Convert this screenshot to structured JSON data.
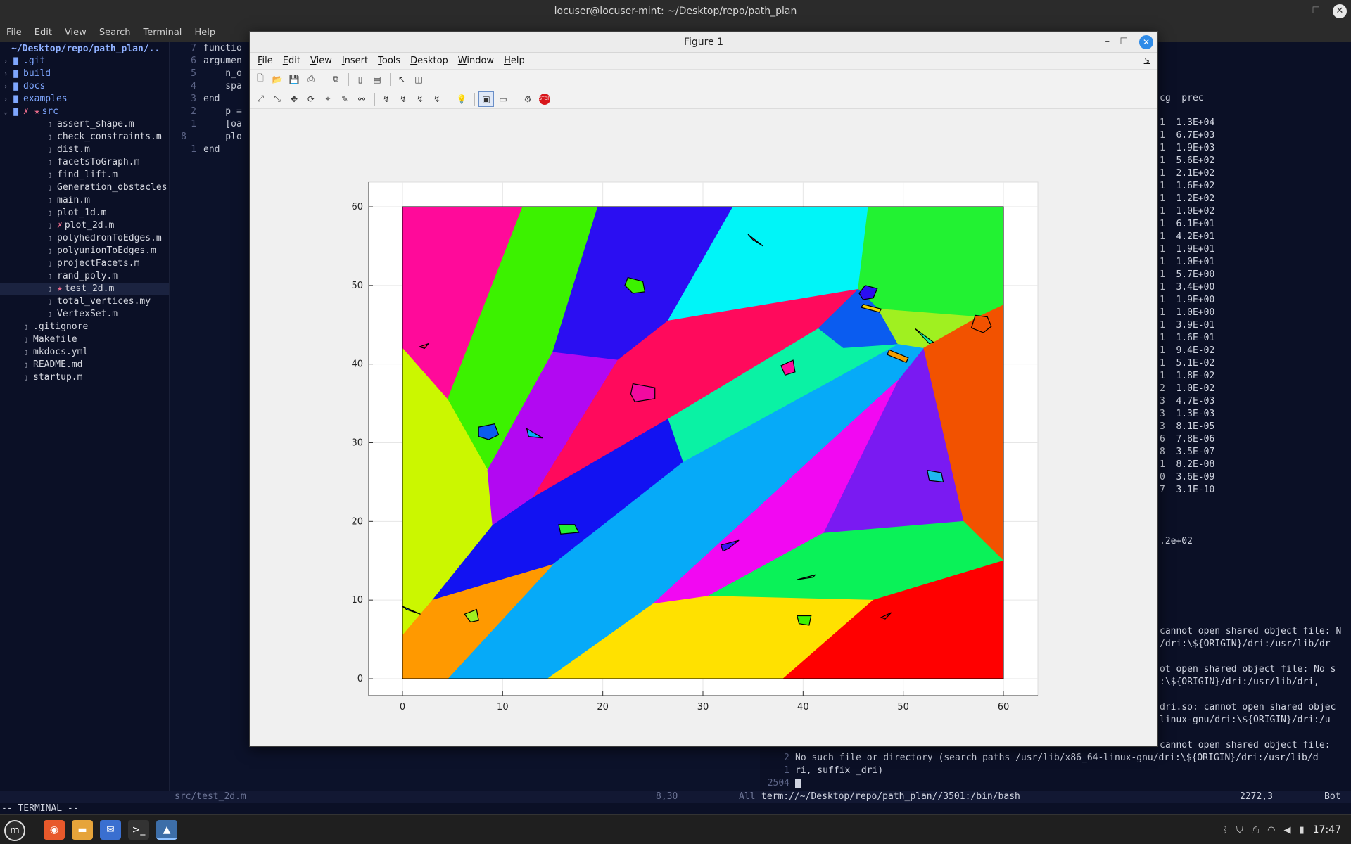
{
  "terminal_window": {
    "title": "locuser@locuser-mint: ~/Desktop/repo/path_plan",
    "menu": [
      "File",
      "Edit",
      "View",
      "Search",
      "Terminal",
      "Help"
    ]
  },
  "file_tree": {
    "root": "~/Desktop/repo/path_plan/..",
    "items": [
      {
        "name": ".git",
        "type": "dir",
        "arrow": "›",
        "marks": ""
      },
      {
        "name": "build",
        "type": "dir",
        "arrow": "›",
        "marks": ""
      },
      {
        "name": "docs",
        "type": "dir",
        "arrow": "›",
        "marks": ""
      },
      {
        "name": "examples",
        "type": "dir",
        "arrow": "›",
        "marks": ""
      },
      {
        "name": "src",
        "type": "dir",
        "arrow": "⌄",
        "marks": "✗ ★"
      },
      {
        "name": "assert_shape.m",
        "type": "file",
        "indent": 1,
        "marks": ""
      },
      {
        "name": "check_constraints.m",
        "type": "file",
        "indent": 1,
        "marks": ""
      },
      {
        "name": "dist.m",
        "type": "file",
        "indent": 1,
        "marks": ""
      },
      {
        "name": "facetsToGraph.m",
        "type": "file",
        "indent": 1,
        "marks": ""
      },
      {
        "name": "find_lift.m",
        "type": "file",
        "indent": 1,
        "marks": ""
      },
      {
        "name": "Generation_obstacles.m",
        "type": "file",
        "indent": 1,
        "marks": ""
      },
      {
        "name": "main.m",
        "type": "file",
        "indent": 1,
        "marks": ""
      },
      {
        "name": "plot_1d.m",
        "type": "file",
        "indent": 1,
        "marks": ""
      },
      {
        "name": "plot_2d.m",
        "type": "file",
        "indent": 1,
        "marks": "✗"
      },
      {
        "name": "polyhedronToEdges.m",
        "type": "file",
        "indent": 1,
        "marks": ""
      },
      {
        "name": "polyunionToEdges.m",
        "type": "file",
        "indent": 1,
        "marks": ""
      },
      {
        "name": "projectFacets.m",
        "type": "file",
        "indent": 1,
        "marks": ""
      },
      {
        "name": "rand_poly.m",
        "type": "file",
        "indent": 1,
        "marks": ""
      },
      {
        "name": "test_2d.m",
        "type": "file",
        "indent": 1,
        "marks": "★",
        "selected": true
      },
      {
        "name": "total_vertices.my",
        "type": "file",
        "indent": 1,
        "marks": ""
      },
      {
        "name": "VertexSet.m",
        "type": "file",
        "indent": 1,
        "marks": ""
      },
      {
        "name": ".gitignore",
        "type": "file",
        "indent": 0,
        "marks": ""
      },
      {
        "name": "Makefile",
        "type": "file",
        "indent": 0,
        "marks": ""
      },
      {
        "name": "mkdocs.yml",
        "type": "file",
        "indent": 0,
        "marks": ""
      },
      {
        "name": "README.md",
        "type": "file",
        "indent": 0,
        "marks": ""
      },
      {
        "name": "startup.m",
        "type": "file",
        "indent": 0,
        "marks": ""
      }
    ]
  },
  "editor": {
    "lines": [
      {
        "ln": "7",
        "text": "functio"
      },
      {
        "ln": "6",
        "text": "argumen"
      },
      {
        "ln": "5",
        "text": "    n_o"
      },
      {
        "ln": "4",
        "text": "    spa"
      },
      {
        "ln": "3",
        "text": "end"
      },
      {
        "ln": "2",
        "text": "    p ="
      },
      {
        "ln": "1",
        "text": "    [oa"
      },
      {
        "ln": "8",
        "text": "    plo"
      },
      {
        "ln": "1",
        "text": "end"
      }
    ]
  },
  "solver_output": {
    "header": "cg  prec",
    "rows": [
      "1  1.3E+04",
      "1  6.7E+03",
      "1  1.9E+03",
      "1  5.6E+02",
      "1  2.1E+02",
      "1  1.6E+02",
      "1  1.2E+02",
      "1  1.0E+02",
      "1  6.1E+01",
      "1  4.2E+01",
      "1  1.9E+01",
      "1  1.0E+01",
      "1  5.7E+00",
      "1  3.4E+00",
      "1  1.9E+00",
      "1  1.0E+00",
      "1  3.9E-01",
      "1  1.6E-01",
      "1  9.4E-02",
      "1  5.1E-02",
      "1  1.8E-02",
      "2  1.0E-02",
      "3  4.7E-03",
      "3  1.3E-03",
      "3  8.1E-05",
      "6  7.8E-06",
      "8  3.5E-07",
      "1  8.2E-08",
      "0  3.6E-09",
      "7  3.1E-10"
    ],
    "tail_value": ".2e+02",
    "errors": [
      "cannot open shared object file: N",
      "/dri:\\${ORIGIN}/dri:/usr/lib/dr",
      "ot open shared object file: No s",
      ":\\${ORIGIN}/dri:/usr/lib/dri,",
      "dri.so: cannot open shared objec",
      "linux-gnu/dri:\\${ORIGIN}/dri:/u",
      "cannot open shared object file:"
    ]
  },
  "bottom_terminal": {
    "lines": [
      {
        "ln": "2",
        "text": "No such file or directory (search paths /usr/lib/x86_64-linux-gnu/dri:\\${ORIGIN}/dri:/usr/lib/d"
      },
      {
        "ln": "1",
        "text": "ri, suffix _dri)"
      },
      {
        "ln": "2504",
        "text": ""
      }
    ]
  },
  "statusline": {
    "left_file": "src/test_2d.m",
    "left_pos": "8,30",
    "left_all": "All",
    "term_path": "term://~/Desktop/repo/path_plan//3501:/bin/bash",
    "right_pos": "2272,3",
    "right_bot": "Bot"
  },
  "mode": "-- TERMINAL --",
  "figure": {
    "title": "Figure 1",
    "menu": [
      "File",
      "Edit",
      "View",
      "Insert",
      "Tools",
      "Desktop",
      "Window",
      "Help"
    ]
  },
  "taskbar": {
    "clock": "17:47"
  },
  "chart_data": {
    "type": "polygon-partition",
    "xlim": [
      0,
      60
    ],
    "ylim": [
      0,
      60
    ],
    "xticks": [
      0,
      10,
      20,
      30,
      40,
      50,
      60
    ],
    "yticks": [
      0,
      10,
      20,
      30,
      40,
      50,
      60
    ],
    "regions": [
      {
        "color": "#ff0a9a",
        "pts": [
          [
            0,
            60
          ],
          [
            12,
            60
          ],
          [
            4.5,
            35.5
          ],
          [
            0,
            42
          ]
        ]
      },
      {
        "color": "#3cf200",
        "pts": [
          [
            12,
            60
          ],
          [
            19.5,
            60
          ],
          [
            15,
            41.5
          ],
          [
            8.5,
            26.5
          ],
          [
            4.5,
            35.5
          ]
        ]
      },
      {
        "color": "#2b0ef2",
        "pts": [
          [
            19.5,
            60
          ],
          [
            33,
            60
          ],
          [
            26.5,
            45.5
          ],
          [
            21.5,
            40.5
          ],
          [
            15,
            41.5
          ]
        ]
      },
      {
        "color": "#00f5f8",
        "pts": [
          [
            33,
            60
          ],
          [
            46.5,
            60
          ],
          [
            45.5,
            49.5
          ],
          [
            26.5,
            45.5
          ]
        ]
      },
      {
        "color": "#22f232",
        "pts": [
          [
            46.5,
            60
          ],
          [
            60,
            60
          ],
          [
            60,
            47.5
          ],
          [
            57.5,
            46
          ],
          [
            47.5,
            47
          ],
          [
            45.5,
            49.5
          ]
        ]
      },
      {
        "color": "#cbf700",
        "pts": [
          [
            0,
            42
          ],
          [
            4.5,
            35.5
          ],
          [
            8.5,
            26.5
          ],
          [
            9,
            19.5
          ],
          [
            3,
            10
          ],
          [
            0,
            5.5
          ]
        ]
      },
      {
        "color": "#b208f2",
        "pts": [
          [
            15,
            41.5
          ],
          [
            21.5,
            40.5
          ],
          [
            13,
            23
          ],
          [
            9,
            19.5
          ],
          [
            8.5,
            26.5
          ]
        ]
      },
      {
        "color": "#ff0a5c",
        "pts": [
          [
            21.5,
            40.5
          ],
          [
            26.5,
            45.5
          ],
          [
            45.5,
            49.5
          ],
          [
            41.5,
            44.5
          ],
          [
            26.5,
            33
          ],
          [
            13,
            23
          ]
        ]
      },
      {
        "color": "#0a5cf0",
        "pts": [
          [
            45.5,
            49.5
          ],
          [
            47.5,
            47
          ],
          [
            49.5,
            42.5
          ],
          [
            44,
            42
          ],
          [
            41.5,
            44.5
          ]
        ]
      },
      {
        "color": "#a0f020",
        "pts": [
          [
            47.5,
            47
          ],
          [
            57.5,
            46
          ],
          [
            52,
            42
          ],
          [
            49.5,
            42.5
          ]
        ]
      },
      {
        "color": "#0af2a4",
        "pts": [
          [
            41.5,
            44.5
          ],
          [
            44,
            42
          ],
          [
            49.5,
            42.5
          ],
          [
            28,
            27.5
          ],
          [
            26.5,
            33
          ]
        ]
      },
      {
        "color": "#f25200",
        "pts": [
          [
            57.5,
            46
          ],
          [
            60,
            47.5
          ],
          [
            60,
            15
          ],
          [
            56,
            20
          ],
          [
            52,
            42
          ]
        ]
      },
      {
        "color": "#7a1af2",
        "pts": [
          [
            52,
            42
          ],
          [
            56,
            20
          ],
          [
            42,
            18.5
          ],
          [
            49.5,
            38
          ]
        ]
      },
      {
        "color": "#1212f2",
        "pts": [
          [
            13,
            23
          ],
          [
            26.5,
            33
          ],
          [
            28,
            27.5
          ],
          [
            15,
            14.5
          ],
          [
            3,
            10
          ],
          [
            9,
            19.5
          ]
        ]
      },
      {
        "color": "#06aaf8",
        "pts": [
          [
            49.5,
            42.5
          ],
          [
            52,
            42
          ],
          [
            49.5,
            38
          ],
          [
            25,
            9.5
          ],
          [
            14.5,
            0
          ],
          [
            4.5,
            0
          ],
          [
            15,
            14.5
          ],
          [
            28,
            27.5
          ]
        ]
      },
      {
        "color": "#f208f2",
        "pts": [
          [
            49.5,
            38
          ],
          [
            42,
            18.5
          ],
          [
            30.5,
            10.5
          ],
          [
            25,
            9.5
          ]
        ]
      },
      {
        "color": "#0af258",
        "pts": [
          [
            42,
            18.5
          ],
          [
            56,
            20
          ],
          [
            60,
            15
          ],
          [
            47,
            10
          ],
          [
            30.5,
            10.5
          ]
        ]
      },
      {
        "color": "#ff9900",
        "pts": [
          [
            0,
            5.5
          ],
          [
            3,
            10
          ],
          [
            15,
            14.5
          ],
          [
            4.5,
            0
          ],
          [
            0,
            0
          ]
        ]
      },
      {
        "color": "#ffe100",
        "pts": [
          [
            14.5,
            0
          ],
          [
            25,
            9.5
          ],
          [
            30.5,
            10.5
          ],
          [
            47,
            10
          ],
          [
            38,
            0
          ]
        ]
      },
      {
        "color": "#ff0000",
        "pts": [
          [
            38,
            0
          ],
          [
            47,
            10
          ],
          [
            60,
            15
          ],
          [
            60,
            0
          ]
        ]
      }
    ],
    "obstacles": [
      {
        "color": "#ff0a5c",
        "pts": [
          [
            34.5,
            56.5
          ],
          [
            36,
            55
          ],
          [
            35,
            55.8
          ]
        ]
      },
      {
        "color": "#3cf200",
        "pts": [
          [
            22.5,
            51
          ],
          [
            24,
            50.5
          ],
          [
            24.2,
            49.2
          ],
          [
            23,
            49
          ],
          [
            22.2,
            50
          ]
        ]
      },
      {
        "color": "#2b0ef2",
        "pts": [
          [
            46.2,
            50
          ],
          [
            47.4,
            49.6
          ],
          [
            47,
            48.4
          ],
          [
            46,
            48.2
          ],
          [
            45.6,
            49
          ]
        ]
      },
      {
        "color": "#f2d000",
        "pts": [
          [
            46,
            47.6
          ],
          [
            47.8,
            47
          ],
          [
            47.6,
            46.6
          ],
          [
            45.8,
            47.2
          ]
        ]
      },
      {
        "color": "#0af2a4",
        "pts": [
          [
            51.2,
            44.5
          ],
          [
            53,
            42.8
          ],
          [
            52.6,
            42.6
          ]
        ]
      },
      {
        "color": "#f25200",
        "pts": [
          [
            57.2,
            46.2
          ],
          [
            58.4,
            46
          ],
          [
            58.8,
            44.8
          ],
          [
            58,
            44
          ],
          [
            56.8,
            44.6
          ]
        ]
      },
      {
        "color": "#f29c00",
        "pts": [
          [
            48.6,
            41.8
          ],
          [
            50.5,
            40.8
          ],
          [
            50.3,
            40.2
          ],
          [
            48.4,
            41.2
          ]
        ]
      },
      {
        "color": "#ff0a9a",
        "pts": [
          [
            37.8,
            39.8
          ],
          [
            39,
            40.5
          ],
          [
            39.2,
            39
          ],
          [
            38.2,
            38.6
          ]
        ]
      },
      {
        "color": "#f20aa0",
        "pts": [
          [
            23,
            37.5
          ],
          [
            25.2,
            37
          ],
          [
            25.2,
            35.6
          ],
          [
            23.2,
            35.2
          ],
          [
            22.8,
            36.2
          ]
        ]
      },
      {
        "color": "#ff0a5c",
        "pts": [
          [
            1.7,
            42.2
          ],
          [
            2.6,
            42.6
          ],
          [
            2.2,
            42
          ]
        ]
      },
      {
        "color": "#0a5cf0",
        "pts": [
          [
            7.6,
            32
          ],
          [
            9.2,
            32.4
          ],
          [
            9.6,
            31
          ],
          [
            8.6,
            30.4
          ],
          [
            7.6,
            30.8
          ]
        ]
      },
      {
        "color": "#06aaf8",
        "pts": [
          [
            12.4,
            31.8
          ],
          [
            14,
            30.6
          ],
          [
            12.6,
            30.8
          ]
        ]
      },
      {
        "color": "#1fb8f0",
        "pts": [
          [
            52.4,
            26.5
          ],
          [
            53.8,
            26.2
          ],
          [
            54,
            25
          ],
          [
            52.6,
            25.2
          ]
        ]
      },
      {
        "color": "#22f232",
        "pts": [
          [
            15.6,
            19.6
          ],
          [
            17.2,
            19.6
          ],
          [
            17.6,
            18.6
          ],
          [
            15.8,
            18.4
          ]
        ]
      },
      {
        "color": "#3a14f2",
        "pts": [
          [
            31.8,
            17
          ],
          [
            33.6,
            17.6
          ],
          [
            32.6,
            16.6
          ],
          [
            32,
            16.2
          ]
        ]
      },
      {
        "color": "#0af258",
        "pts": [
          [
            39.4,
            12.6
          ],
          [
            41.2,
            13.2
          ],
          [
            41,
            12.9
          ]
        ]
      },
      {
        "color": "#a0f020",
        "pts": [
          [
            6.2,
            8.2
          ],
          [
            7.4,
            8.8
          ],
          [
            7.6,
            7.4
          ],
          [
            6.8,
            7.2
          ]
        ]
      },
      {
        "color": "#06aaf8",
        "pts": [
          [
            0,
            9.2
          ],
          [
            1.8,
            8.2
          ],
          [
            0.4,
            8.8
          ]
        ]
      },
      {
        "color": "#3cf200",
        "pts": [
          [
            39.4,
            8
          ],
          [
            40.8,
            8
          ],
          [
            40.6,
            6.8
          ],
          [
            39.6,
            7
          ]
        ]
      },
      {
        "color": "#ff0000",
        "pts": [
          [
            47.8,
            7.8
          ],
          [
            48.8,
            8.4
          ],
          [
            48.2,
            7.6
          ]
        ]
      }
    ]
  }
}
